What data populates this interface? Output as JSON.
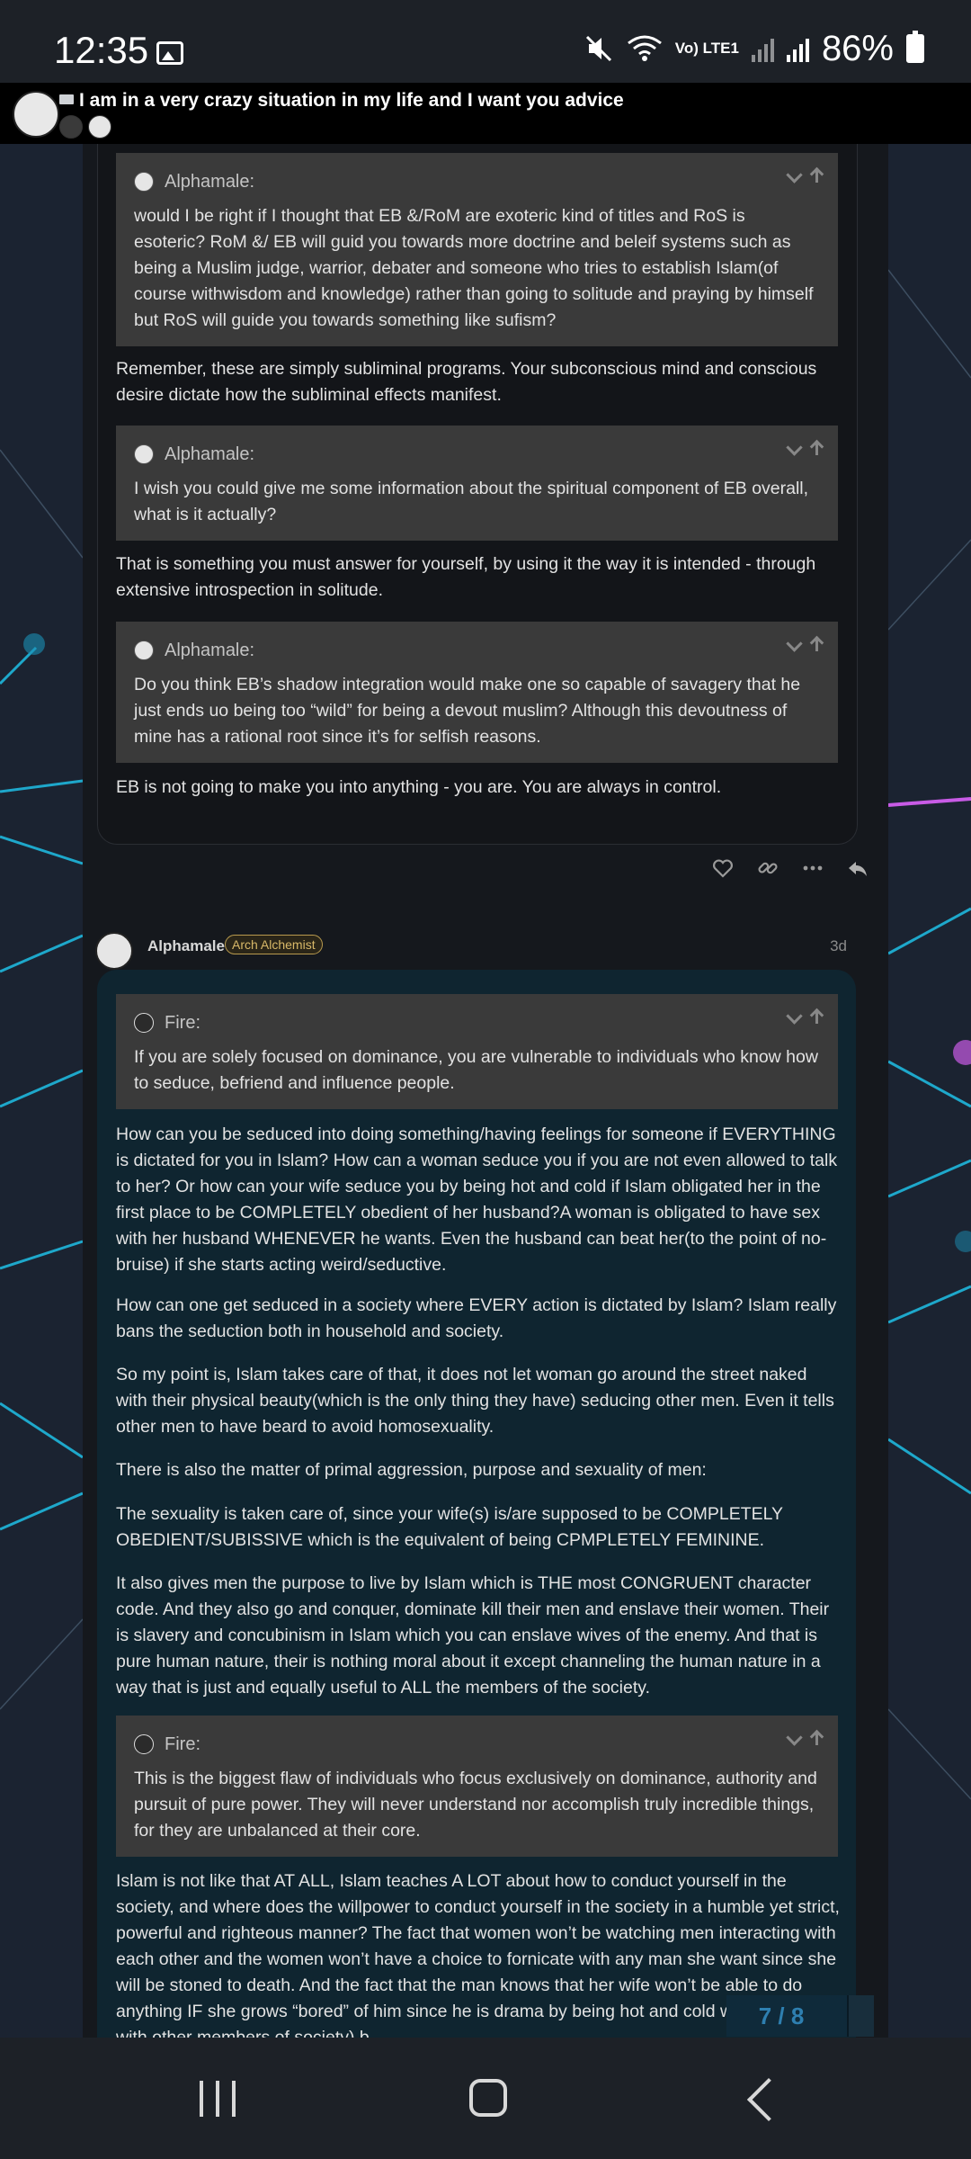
{
  "status_bar": {
    "time": "12:35",
    "network": "Vo) LTE1",
    "battery": "86%"
  },
  "topic": {
    "title": "I am in a very crazy situation in my life and I want you advice"
  },
  "post1": {
    "blocks": [
      {
        "type": "quote",
        "user": "Alphamale:",
        "text": "would I be right if I thought that EB &/RoM are exoteric kind of titles and RoS is esoteric? RoM &/ EB will guid you towards more doctrine and beleif systems such as being a Muslim judge, warrior, debater and someone who tries to establish Islam(of course withwisdom and knowledge) rather than going to solitude and praying by himself but RoS will guide you towards something like sufism?"
      },
      {
        "type": "para",
        "text": "Remember, these are simply subliminal programs. Your subconscious mind and conscious desire dictate how the subliminal effects manifest."
      },
      {
        "type": "quote",
        "user": "Alphamale:",
        "text": "I wish you could give me some information about the spiritual component of EB overall, what is it actually?"
      },
      {
        "type": "para",
        "text": "That is something you must answer for yourself, by using it the way it is intended - through extensive introspection in solitude."
      },
      {
        "type": "quote",
        "user": "Alphamale:",
        "text": "Do you think EB’s shadow integration would make one so capable of savagery that he just ends uo being too “wild” for being a devout muslim? Although this devoutness of mine has a rational root since it’s for selfish reasons."
      },
      {
        "type": "para",
        "text": "EB is not going to make you into anything - you are. You are always in control."
      }
    ]
  },
  "post2": {
    "username": "Alphamale",
    "flair": "Arch Alchemist",
    "date": "3d",
    "blocks": [
      {
        "type": "quote",
        "user": "Fire:",
        "text": "If you are solely focused on dominance, you are vulnerable to individuals who know how to seduce, befriend and influence people."
      },
      {
        "type": "para",
        "text": "How can you be seduced into doing something/having feelings for someone if EVERYTHING is dictated for you in Islam? How can a woman seduce you if you are not even allowed to talk to her? Or how can your wife seduce you by being hot and cold if Islam obligated her in the first place to be COMPLETELY obedient of her husband?A woman is obligated to have sex with her husband WHENEVER he wants. Even the husband can beat her(to the point of no-bruise) if she starts acting weird/seductive."
      },
      {
        "type": "para",
        "text": "How can one get seduced in a society where EVERY action is dictated by Islam? Islam really bans the seduction both in household and society."
      },
      {
        "type": "para",
        "text": "So my point is, Islam takes care of that, it does not let woman go around the street naked with their physical beauty(which is the only thing they have) seducing other men. Even it tells other men to have beard to avoid homosexuality."
      },
      {
        "type": "para",
        "text": "There is also the matter of primal aggression, purpose and sexuality of men:"
      },
      {
        "type": "para",
        "text": "The sexuality is taken care of, since your wife(s) is/are supposed to be COMPLETELY OBEDIENT/SUBISSIVE which is the equivalent of being CPMPLETELY FEMININE."
      },
      {
        "type": "para",
        "text": "It also gives men the purpose to live by Islam which is THE most CONGRUENT character code. And they also go and conquer, dominate kill their men and enslave their women. Their is slavery and concubinism in Islam which you can enslave wives of the enemy. And that is pure human nature, their is nothing moral about it except channeling the human nature in a way that is just and equally useful to ALL the members of the society."
      },
      {
        "type": "quote",
        "user": "Fire:",
        "text": "This is the biggest flaw of individuals who focus exclusively on dominance, authority and pursuit of pure power. They will never understand nor accomplish truly incredible things, for they are unbalanced at their core."
      },
      {
        "type": "para",
        "text": "Islam is not like that AT ALL, Islam teaches A LOT about how to conduct yourself in the society, and where does the willpower to conduct yourself in the society in a humble yet strict, powerful and righteous manner? The fact that women won’t be watching men interacting with each other and the women won’t have a choice to fornicate with any man she want since she will be stoned to death. And the fact that the man knows that her wife won’t be able to do anything IF she grows “bored” of him since he is drama by being hot and cold with her(and with other members of society) b"
      }
    ]
  },
  "progress": {
    "label": "7 / 8"
  },
  "icons": {
    "status": [
      "gallery-icon",
      "mute-icon",
      "wifi-icon",
      "signal-icon",
      "battery-icon"
    ],
    "actions": [
      "heart-icon",
      "link-icon",
      "more-icon",
      "reply-icon"
    ],
    "nav": [
      "recent-apps-icon",
      "home-icon",
      "back-icon"
    ]
  },
  "colors": {
    "accent": "#2e7fb0",
    "flair": "#d8b868",
    "network_lines": "#1ec0e8"
  }
}
